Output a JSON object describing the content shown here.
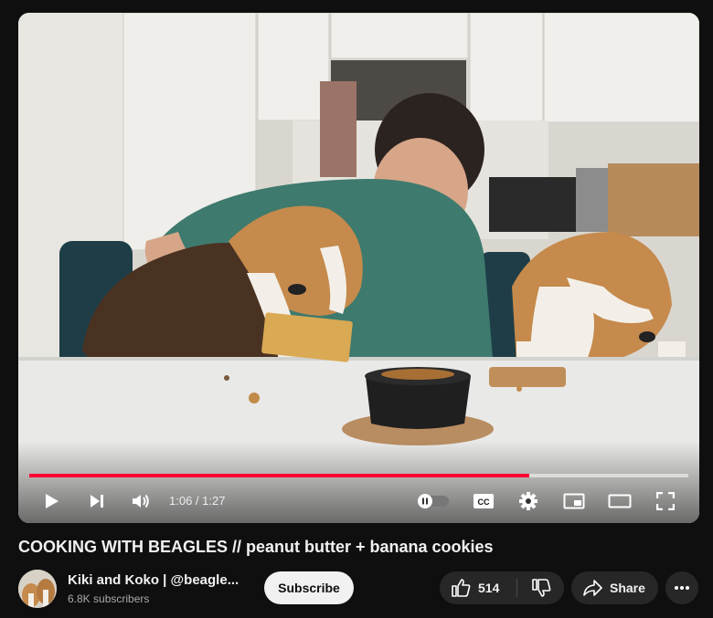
{
  "video": {
    "time_current": "1:06",
    "time_separator": " / ",
    "time_total": "1:27",
    "progress_fraction": 0.758,
    "buffer_fraction": 1.0,
    "autoplay_on": false,
    "icons": {
      "play": "play-icon",
      "next": "next-icon",
      "volume": "volume-icon",
      "autoplay": "autoplay-toggle",
      "captions": "cc-icon",
      "settings": "gear-icon",
      "miniplayer": "miniplayer-icon",
      "theater": "theater-icon",
      "fullscreen": "fullscreen-icon"
    },
    "captions_label": "CC"
  },
  "title": "COOKING WITH BEAGLES // peanut butter + banana cookies",
  "channel": {
    "name": "Kiki and Koko | @beagle...",
    "subscribers": "6.8K subscribers"
  },
  "actions": {
    "subscribe_label": "Subscribe",
    "like_count": "514",
    "share_label": "Share"
  },
  "colors": {
    "background": "#0f0f0f",
    "progress_played": "#ff0033",
    "pill": "#272727",
    "subscribe_bg": "#f1f1f1"
  }
}
